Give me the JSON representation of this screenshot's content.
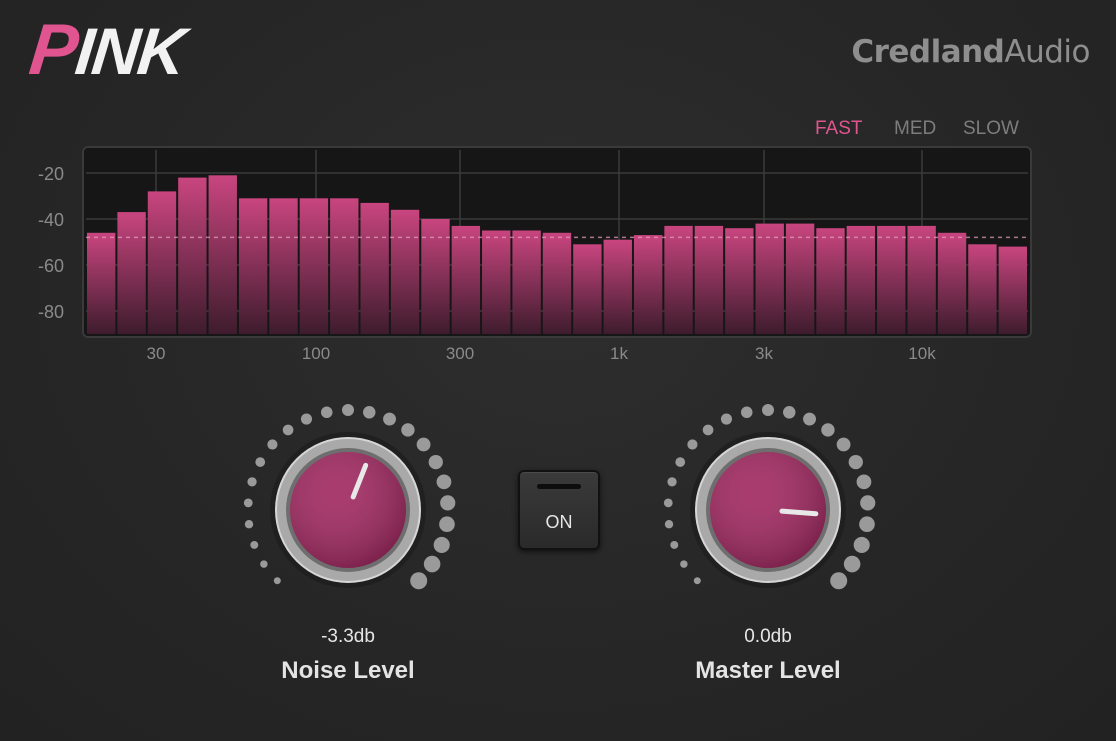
{
  "logo": {
    "p": "P",
    "rest": "INK"
  },
  "brand": {
    "bold": "Credland",
    "light": "Audio"
  },
  "speed": [
    {
      "label": "FAST",
      "active": true
    },
    {
      "label": "MED",
      "active": false
    },
    {
      "label": "SLOW",
      "active": false
    }
  ],
  "spectrum": {
    "y_ticks": [
      "-20",
      "-40",
      "-60",
      "-80"
    ],
    "x_ticks": [
      "30",
      "100",
      "300",
      "1k",
      "3k",
      "10k"
    ],
    "bar_levels_db": [
      -46,
      -37,
      -28,
      -22,
      -21,
      -31,
      -31,
      -31,
      -31,
      -33,
      -36,
      -40,
      -43,
      -45,
      -45,
      -46,
      -51,
      -49,
      -47,
      -43,
      -43,
      -44,
      -42,
      -42,
      -44,
      -43,
      -43,
      -43,
      -46,
      -51,
      -52
    ],
    "reference_db": -48,
    "colors": {
      "bar_top": "#c9457f",
      "bar_bottom": "#3e1c2d",
      "accent": "#e0558f"
    }
  },
  "power": {
    "label": "ON",
    "state": "on"
  },
  "knobs": {
    "noise": {
      "value": "-3.3db",
      "label": "Noise Level",
      "fraction": 0.58
    },
    "master": {
      "value": "0.0db",
      "label": "Master Level",
      "fraction": 0.85
    }
  }
}
